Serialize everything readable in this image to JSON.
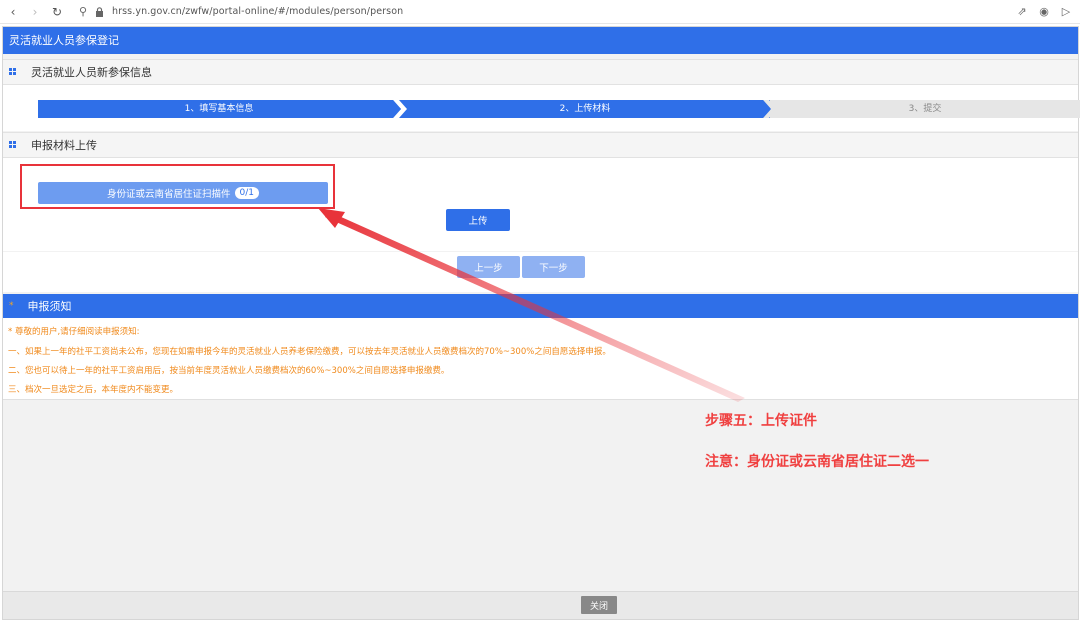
{
  "browser": {
    "url": "hrss.yn.gov.cn/zwfw/portal-online/#/modules/person/person"
  },
  "app": {
    "title": "灵活就业人员参保登记"
  },
  "section_info": {
    "title": "灵活就业人员新参保信息"
  },
  "steps": [
    {
      "label": "1、填写基本信息",
      "state": "active"
    },
    {
      "label": "2、上传材料",
      "state": "active"
    },
    {
      "label": "3、提交",
      "state": "inactive"
    }
  ],
  "section_upload": {
    "title": "申报材料上传",
    "doc_label": "身份证或云南省居住证扫描件",
    "doc_count": "0/1",
    "upload_label": "上传"
  },
  "navigation": {
    "prev_label": "上一步",
    "next_label": "下一步"
  },
  "notice": {
    "title": "申报须知",
    "lines": [
      "* 尊敬的用户,请仔细阅读申报须知:",
      "一、如果上一年的社平工资尚未公布，您现在如需申报今年的灵活就业人员养老保险缴费，可以按去年灵活就业人员缴费档次的70%~300%之间自愿选择申报。",
      "二、您也可以待上一年的社平工资启用后，按当前年度灵活就业人员缴费档次的60%~300%之间自愿选择申报缴费。",
      "三、档次一旦选定之后，本年度内不能变更。"
    ]
  },
  "footer": {
    "close_label": "关闭"
  },
  "annotation": {
    "line1": "步骤五：上传证件",
    "line2": "注意：身份证或云南省居住证二选一"
  },
  "colors": {
    "primary": "#2f6fe8",
    "primary_light": "#6d9cf0",
    "notice_text": "#f08a1c",
    "annotation_red": "#e8333a"
  }
}
